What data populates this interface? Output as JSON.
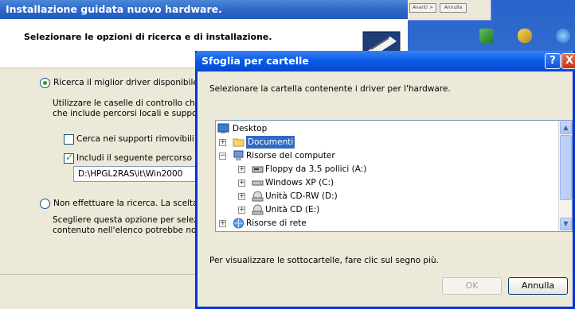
{
  "wizard": {
    "title": "Installazione guidata nuovo hardware.",
    "header_title": "Selezionare le opzioni di ricerca e di installazione.",
    "option_search_label": "Ricerca il miglior driver disponibile in q",
    "option_search_desc_1": "Utilizzare le caselle di controllo che se",
    "option_search_desc_2": "che include percorsi locali e supporti r",
    "check_removable_label": "Cerca nei supporti rimovibili (uni",
    "check_path_label": "Includi il seguente percorso nel",
    "path_value": "D:\\HPGL2RAS\\it\\Win2000",
    "option_nosearch_label": "Non effettuare la ricerca. La scelta de",
    "option_nosearch_desc_1": "Scegliere questa opzione per selezion",
    "option_nosearch_desc_2": "contenuto nell'elenco potrebbe non es"
  },
  "background_dialog": {
    "back_label": "Avanti >",
    "cancel_label": "Annulla"
  },
  "dialog": {
    "title": "Sfoglia per cartelle",
    "help_label": "?",
    "close_label": "X",
    "description": "Selezionare la cartella contenente i driver per l'hardware.",
    "tree": [
      {
        "label": "Desktop",
        "icon": "desktop-icon"
      },
      {
        "label": "Documenti",
        "icon": "folder-icon",
        "selected": true
      },
      {
        "label": "Risorse del computer",
        "icon": "computer-icon"
      },
      {
        "label": "Floppy da 3,5 pollici (A:)",
        "icon": "floppy-drive-icon"
      },
      {
        "label": "Windows XP (C:)",
        "icon": "hard-drive-icon"
      },
      {
        "label": "Unità CD-RW (D:)",
        "icon": "cd-drive-icon"
      },
      {
        "label": "Unità CD (E:)",
        "icon": "cd-drive-icon"
      },
      {
        "label": "Risorse di rete",
        "icon": "network-icon"
      },
      {
        "label": "",
        "icon": "folder-icon"
      }
    ],
    "expander_plus": "+",
    "expander_minus": "−",
    "scroll_up": "▲",
    "scroll_down": "▼",
    "hint": "Per visualizzare le sottocartelle, fare clic sul segno più.",
    "ok_label": "OK",
    "cancel_label": "Annulla"
  },
  "colors": {
    "title_blue": "#0548d3",
    "selection": "#316ac5"
  }
}
